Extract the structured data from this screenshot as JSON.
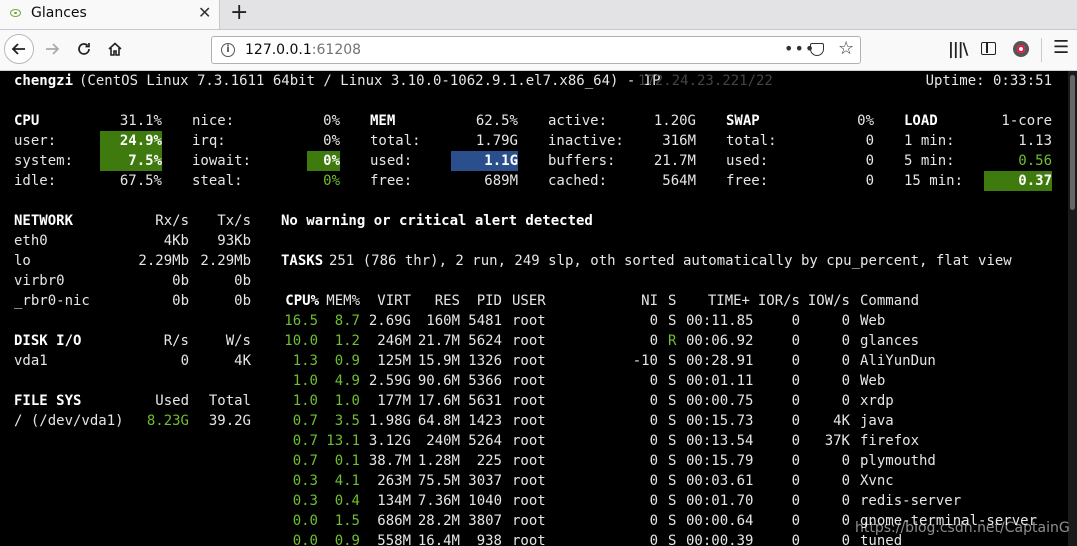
{
  "browser": {
    "tab_title": "Glances",
    "url_host": "127.0.0.1",
    "url_port": ":61208"
  },
  "header": {
    "hostname": "chengzi",
    "os_info": "(CentOS Linux 7.3.1611 64bit / Linux 3.10.0-1062.9.1.el7.x86_64) - IP",
    "ip_masked": "172.24.23.221/22",
    "uptime": "Uptime: 0:33:51"
  },
  "cpu": {
    "label": "CPU",
    "total": "31.1%",
    "rows": [
      {
        "k": "user:",
        "v": "24.9%"
      },
      {
        "k": "system:",
        "v": "7.5%"
      },
      {
        "k": "idle:",
        "v": "67.5%"
      }
    ],
    "rows2": [
      {
        "k": "nice:",
        "v": "0%"
      },
      {
        "k": "irq:",
        "v": "0%"
      },
      {
        "k": "iowait:",
        "v": "0%"
      },
      {
        "k": "steal:",
        "v": "0%"
      }
    ]
  },
  "mem": {
    "label": "MEM",
    "total_pct": "62.5%",
    "rows": [
      {
        "k": "total:",
        "v": "1.79G"
      },
      {
        "k": "used:",
        "v": "1.1G"
      },
      {
        "k": "free:",
        "v": "689M"
      }
    ],
    "rows2": [
      {
        "k": "active:",
        "v": "1.20G"
      },
      {
        "k": "inactive:",
        "v": "316M"
      },
      {
        "k": "buffers:",
        "v": "21.7M"
      },
      {
        "k": "cached:",
        "v": "564M"
      }
    ]
  },
  "swap": {
    "label": "SWAP",
    "pct": "0%",
    "rows": [
      {
        "k": "total:",
        "v": "0"
      },
      {
        "k": "used:",
        "v": "0"
      },
      {
        "k": "free:",
        "v": "0"
      }
    ]
  },
  "load": {
    "label": "LOAD",
    "cores": "1-core",
    "rows": [
      {
        "k": "1 min:",
        "v": "1.13"
      },
      {
        "k": "5 min:",
        "v": "0.56"
      },
      {
        "k": "15 min:",
        "v": "0.37"
      }
    ]
  },
  "network": {
    "label": "NETWORK",
    "rx": "Rx/s",
    "tx": "Tx/s",
    "rows": [
      {
        "name": "eth0",
        "rx": "4Kb",
        "tx": "93Kb"
      },
      {
        "name": "lo",
        "rx": "2.29Mb",
        "tx": "2.29Mb"
      },
      {
        "name": "virbr0",
        "rx": "0b",
        "tx": "0b"
      },
      {
        "name": "_rbr0-nic",
        "rx": "0b",
        "tx": "0b"
      }
    ]
  },
  "disk": {
    "label": "DISK I/O",
    "r": "R/s",
    "w": "W/s",
    "rows": [
      {
        "name": "vda1",
        "r": "0",
        "w": "4K"
      }
    ]
  },
  "fs": {
    "label": "FILE SYS",
    "used": "Used",
    "total": "Total",
    "rows": [
      {
        "name": "/ (/dev/vda1)",
        "used": "8.23G",
        "total": "39.2G"
      }
    ]
  },
  "alert": "No warning or critical alert detected",
  "tasks": {
    "label": "TASKS",
    "summary": "251 (786 thr), 2 run, 249 slp, oth sorted automatically by cpu_percent, flat view"
  },
  "proc_headers": {
    "cpu": "CPU%",
    "mem": "MEM%",
    "virt": "VIRT",
    "res": "RES",
    "pid": "PID",
    "user": "USER",
    "ni": "NI",
    "s": "S",
    "time": "TIME+",
    "ior": "IOR/s",
    "iow": "IOW/s",
    "cmd": "Command"
  },
  "processes": [
    {
      "cpu": "16.5",
      "mem": "8.7",
      "virt": "2.69G",
      "res": "160M",
      "pid": "5481",
      "user": "root",
      "ni": "0",
      "s": "S",
      "time": "00:11.85",
      "ior": "0",
      "iow": "0",
      "cmd": "Web"
    },
    {
      "cpu": "10.0",
      "mem": "1.2",
      "virt": "246M",
      "res": "21.7M",
      "pid": "5624",
      "user": "root",
      "ni": "0",
      "s": "R",
      "time": "00:06.92",
      "ior": "0",
      "iow": "0",
      "cmd": "glances"
    },
    {
      "cpu": "1.3",
      "mem": "0.9",
      "virt": "125M",
      "res": "15.9M",
      "pid": "1326",
      "user": "root",
      "ni": "-10",
      "s": "S",
      "time": "00:28.91",
      "ior": "0",
      "iow": "0",
      "cmd": "AliYunDun"
    },
    {
      "cpu": "1.0",
      "mem": "4.9",
      "virt": "2.59G",
      "res": "90.6M",
      "pid": "5366",
      "user": "root",
      "ni": "0",
      "s": "S",
      "time": "00:01.11",
      "ior": "0",
      "iow": "0",
      "cmd": "Web"
    },
    {
      "cpu": "1.0",
      "mem": "1.0",
      "virt": "177M",
      "res": "17.6M",
      "pid": "5631",
      "user": "root",
      "ni": "0",
      "s": "S",
      "time": "00:00.75",
      "ior": "0",
      "iow": "0",
      "cmd": "xrdp"
    },
    {
      "cpu": "0.7",
      "mem": "3.5",
      "virt": "1.98G",
      "res": "64.8M",
      "pid": "1423",
      "user": "root",
      "ni": "0",
      "s": "S",
      "time": "00:15.73",
      "ior": "0",
      "iow": "4K",
      "cmd": "java"
    },
    {
      "cpu": "0.7",
      "mem": "13.1",
      "virt": "3.12G",
      "res": "240M",
      "pid": "5264",
      "user": "root",
      "ni": "0",
      "s": "S",
      "time": "00:13.54",
      "ior": "0",
      "iow": "37K",
      "cmd": "firefox"
    },
    {
      "cpu": "0.7",
      "mem": "0.1",
      "virt": "38.7M",
      "res": "1.28M",
      "pid": "225",
      "user": "root",
      "ni": "0",
      "s": "S",
      "time": "00:15.79",
      "ior": "0",
      "iow": "0",
      "cmd": "plymouthd"
    },
    {
      "cpu": "0.3",
      "mem": "4.1",
      "virt": "263M",
      "res": "75.5M",
      "pid": "3037",
      "user": "root",
      "ni": "0",
      "s": "S",
      "time": "00:03.61",
      "ior": "0",
      "iow": "0",
      "cmd": "Xvnc"
    },
    {
      "cpu": "0.3",
      "mem": "0.4",
      "virt": "134M",
      "res": "7.36M",
      "pid": "1040",
      "user": "root",
      "ni": "0",
      "s": "S",
      "time": "00:01.70",
      "ior": "0",
      "iow": "0",
      "cmd": "redis-server"
    },
    {
      "cpu": "0.0",
      "mem": "1.5",
      "virt": "686M",
      "res": "28.2M",
      "pid": "3807",
      "user": "root",
      "ni": "0",
      "s": "S",
      "time": "00:00.64",
      "ior": "0",
      "iow": "0",
      "cmd": "gnome-terminal-server"
    },
    {
      "cpu": "0.0",
      "mem": "0.9",
      "virt": "558M",
      "res": "16.4M",
      "pid": "938",
      "user": "root",
      "ni": "0",
      "s": "S",
      "time": "00:00.39",
      "ior": "0",
      "iow": "0",
      "cmd": "tuned"
    }
  ],
  "watermark": "https://blog.csdn.net/CaptainG"
}
